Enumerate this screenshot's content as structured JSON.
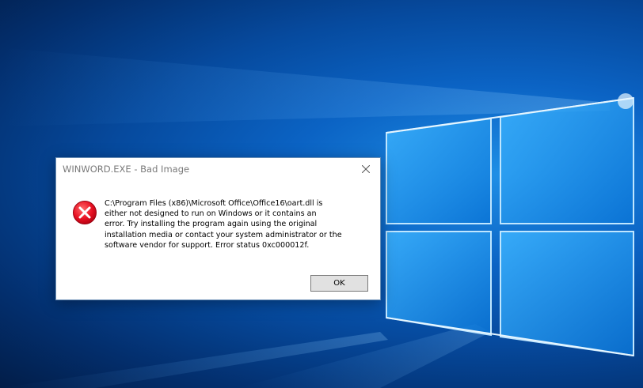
{
  "dialog": {
    "title": "WINWORD.EXE - Bad Image",
    "message": "C:\\Program Files (x86)\\Microsoft Office\\Office16\\oart.dll is\neither not designed to run on Windows or it contains an\nerror. Try installing the program again using the original\ninstallation media or contact your system administrator or the\nsoftware vendor for support. Error status 0xc000012f.",
    "ok_label": "OK",
    "icon": "error-icon",
    "icon_color": "#e81123"
  },
  "desktop": {
    "wallpaper": "windows-10-logo",
    "accent": "#0b63c4"
  }
}
